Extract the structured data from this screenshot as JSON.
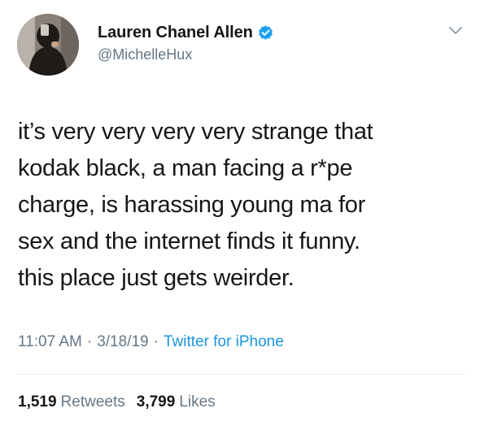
{
  "tweet": {
    "author": {
      "display_name": "Lauren Chanel Allen",
      "handle": "@MichelleHux",
      "verified": true,
      "verified_icon": "verified-badge-icon",
      "avatar_icon": "profile-photo"
    },
    "menu_icon": "chevron-down-icon",
    "text_lines": [
      "it’s very very very very strange that",
      "kodak black, a man facing a r*pe",
      "charge, is harassing young ma for",
      "sex and the internet finds it funny.",
      "this place just gets weirder."
    ],
    "time": "11:07 AM",
    "date": "3/18/19",
    "separator": "·",
    "source": "Twitter for iPhone",
    "stats": {
      "retweets_count": "1,519",
      "retweets_label": "Retweets",
      "likes_count": "3,799",
      "likes_label": "Likes"
    }
  },
  "colors": {
    "text_primary": "#14171a",
    "text_secondary": "#657786",
    "link_blue": "#1b95e0",
    "verified_blue": "#1da1f2",
    "divider": "#e6ecf0",
    "chevron": "#8899a6"
  }
}
